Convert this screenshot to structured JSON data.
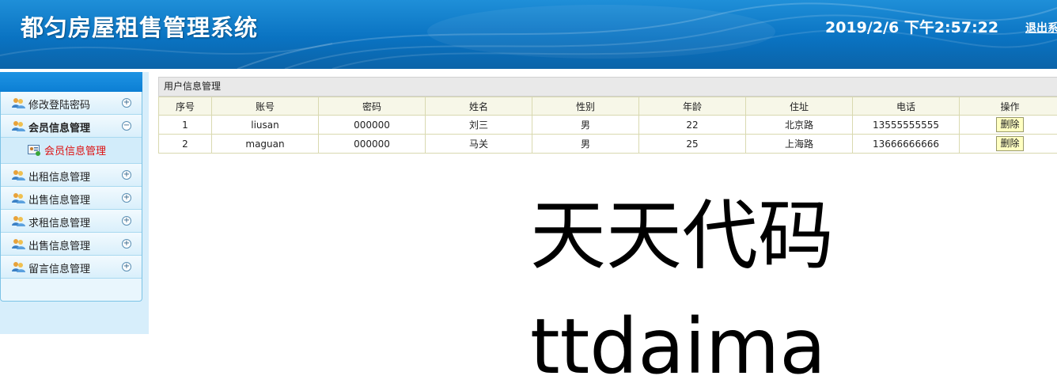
{
  "header": {
    "title": "都匀房屋租售管理系统",
    "clock": "2019/2/6 下午2:57:22",
    "logout_label": "退出系"
  },
  "sidebar": {
    "items": [
      {
        "label": "修改登陆密码",
        "toggle": "+",
        "icon": "users-icon"
      },
      {
        "label": "会员信息管理",
        "toggle": "−",
        "icon": "users-icon",
        "open": true,
        "children": [
          {
            "label": "会员信息管理",
            "icon": "user-card-icon"
          }
        ]
      },
      {
        "label": "出租信息管理",
        "toggle": "+",
        "icon": "users-icon"
      },
      {
        "label": "出售信息管理",
        "toggle": "+",
        "icon": "users-icon"
      },
      {
        "label": "求租信息管理",
        "toggle": "+",
        "icon": "users-icon"
      },
      {
        "label": "出售信息管理",
        "toggle": "+",
        "icon": "users-icon"
      },
      {
        "label": "留言信息管理",
        "toggle": "+",
        "icon": "users-icon"
      }
    ]
  },
  "main": {
    "panel_title": "用户信息管理",
    "columns": [
      "序号",
      "账号",
      "密码",
      "姓名",
      "性别",
      "年龄",
      "住址",
      "电话",
      "操作"
    ],
    "rows": [
      [
        "1",
        "liusan",
        "000000",
        "刘三",
        "男",
        "22",
        "北京路",
        "13555555555"
      ],
      [
        "2",
        "maguan",
        "000000",
        "马关",
        "男",
        "25",
        "上海路",
        "13666666666"
      ]
    ],
    "delete_label": "删除"
  },
  "watermark": {
    "line1": "天天代码",
    "line2": "ttdaima"
  },
  "colors": {
    "header_blue": "#0a73c2",
    "sidebar_bg": "#d7eefb",
    "active_sub": "#dd1111"
  }
}
